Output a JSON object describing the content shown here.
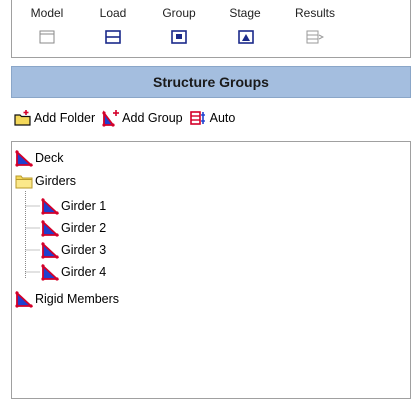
{
  "tabs": [
    {
      "label": "Model",
      "icon": "model-tab-icon"
    },
    {
      "label": "Load",
      "icon": "load-tab-icon"
    },
    {
      "label": "Group",
      "icon": "group-tab-icon"
    },
    {
      "label": "Stage",
      "icon": "stage-tab-icon"
    },
    {
      "label": "Results",
      "icon": "results-tab-icon"
    }
  ],
  "panel": {
    "title": "Structure Groups",
    "header_color": "#a4bedf"
  },
  "toolbar": {
    "add_folder_label": "Add Folder",
    "add_group_label": "Add Group",
    "auto_label": "Auto"
  },
  "tree": {
    "deck": "Deck",
    "girders": "Girders",
    "girder_1": "Girder 1",
    "girder_2": "Girder 2",
    "girder_3": "Girder 3",
    "girder_4": "Girder 4",
    "rigid_members": "Rigid Members"
  },
  "colors": {
    "group_icon": "#d4002a",
    "group_fill": "#1f3fcf",
    "folder": "#f4d85a"
  }
}
